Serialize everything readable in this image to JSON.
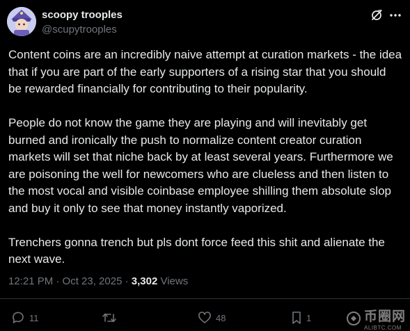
{
  "author": {
    "name": "scoopy trooples",
    "handle": "@scupytrooples"
  },
  "post": {
    "paragraphs": [
      "Content coins are an incredibly naive attempt at curation markets - the idea that if you are part of the early supporters of a rising star that you should be rewarded financially for contributing to their popularity.",
      "People do not know the game they are playing and will inevitably get burned and ironically the push to normalize content creator curation markets will set that niche back by at least several years. Furthermore we are poisoning the well for newcomers who are clueless and then listen to the most vocal and visible coinbase employee shilling them absolute slop and buy it only to see that money instantly vaporized.",
      "Trenchers gonna trench but pls dont force feed this shit and alienate the next wave."
    ],
    "timestamp": "12:21 PM · Oct 23, 2025 · ",
    "views_count": "3,302",
    "views_label": " Views"
  },
  "actions": {
    "replies": "11",
    "reposts": "",
    "likes": "48",
    "bookmarks": "1"
  },
  "watermark": {
    "title": "币圈网",
    "subtitle": "ALIBTC.COM"
  },
  "icons": {
    "grok": "grok-icon",
    "more": "more-icon",
    "reply": "reply-icon",
    "repost": "repost-icon",
    "like": "heart-icon",
    "bookmark": "bookmark-icon",
    "share": "share-icon"
  },
  "colors": {
    "background": "#000000",
    "text": "#e7e9ea",
    "secondary": "#71767b",
    "divider": "#2f3336"
  }
}
